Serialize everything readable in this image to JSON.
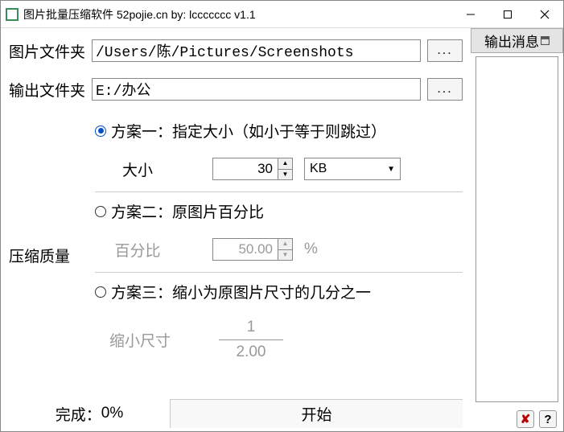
{
  "titlebar": {
    "title": "图片批量压缩软件  52pojie.cn   by: lccccccc     v1.1"
  },
  "input_folder": {
    "label": "图片文件夹",
    "value": "/Users/陈/Pictures/Screenshots",
    "browse": "..."
  },
  "output_folder": {
    "label": "输出文件夹",
    "value": "E:/办公",
    "browse": "..."
  },
  "quality_label": "压缩质量",
  "scheme1": {
    "radio": "方案一：指定大小（如小于等于则跳过）",
    "selected": true,
    "size_label": "大小",
    "size_value": "30",
    "unit_selected": "KB"
  },
  "scheme2": {
    "radio": "方案二：原图片百分比",
    "selected": false,
    "pct_label": "百分比",
    "pct_value": "50.00",
    "pct_unit": "%"
  },
  "scheme3": {
    "radio": "方案三：缩小为原图片尺寸的几分之一",
    "selected": false,
    "shrink_label": "缩小尺寸",
    "numerator": "1",
    "denominator": "2.00"
  },
  "progress": {
    "label_prefix": "完成：",
    "value": "0%"
  },
  "start_button": "开始",
  "output_panel": {
    "tab": "输出消息"
  },
  "toolbar": {
    "close_tip": "✘",
    "help_tip": "?"
  }
}
